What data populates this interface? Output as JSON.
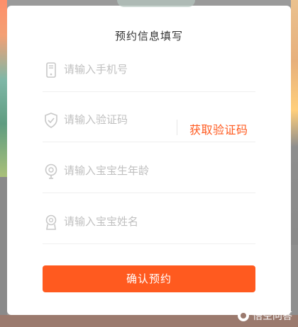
{
  "form": {
    "title": "预约信息填写",
    "phone_placeholder": "请输入手机号",
    "code_placeholder": "请输入验证码",
    "get_code_label": "获取验证码",
    "birthday_placeholder": "请输入宝宝生年龄",
    "name_placeholder": "请输入宝宝姓名",
    "submit_label": "确认预约"
  },
  "icons": {
    "phone": "phone-icon",
    "shield": "shield-check-icon",
    "birthday": "balloon-icon",
    "name": "badge-icon"
  },
  "watermark": {
    "text": "悟空问答"
  },
  "colors": {
    "accent": "#ff5a1f",
    "placeholder": "#c0c0c0",
    "title": "#333333"
  }
}
